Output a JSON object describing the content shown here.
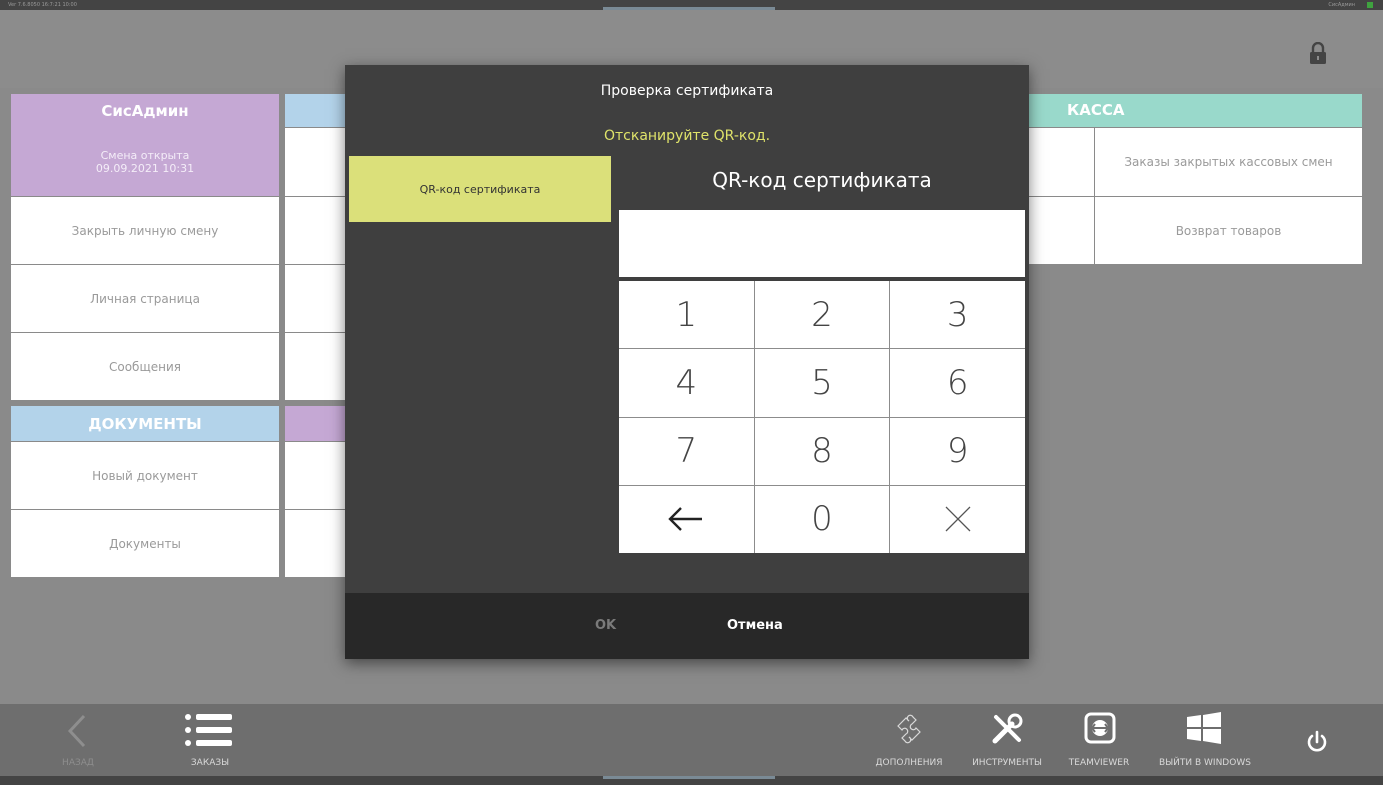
{
  "topbar": {
    "left_text": "Ver 7.6.8050 16:7:21 10:00",
    "right_text": "СисАдмин"
  },
  "user_panel": {
    "title": "СисАдмин",
    "status": "Смена открыта",
    "datetime": "09.09.2021 10:31",
    "items": [
      "Закрыть личную смену",
      "Личная страница",
      "Сообщения"
    ]
  },
  "documents_panel": {
    "title": "ДОКУМЕНТЫ",
    "items": [
      "Новый документ",
      "Документы"
    ]
  },
  "kassa_panel": {
    "title": "КАССА",
    "items": [
      "Заказы закрытых кассовых смен",
      "Возврат товаров"
    ]
  },
  "dialog": {
    "title": "Проверка сертификата",
    "subtitle": "Отсканируйте QR-код.",
    "tab_label": "QR-код сертификата",
    "field_label": "QR-код сертификата",
    "field_value": "",
    "keys": [
      "1",
      "2",
      "3",
      "4",
      "5",
      "6",
      "7",
      "8",
      "9",
      "←",
      "0",
      "×"
    ],
    "ok_label": "OK",
    "cancel_label": "Отмена"
  },
  "bottom": {
    "back_label": "НАЗАД",
    "orders_label": "ЗАКАЗЫ",
    "addons_label": "ДОПОЛНЕНИЯ",
    "tools_label": "ИНСТРУМЕНТЫ",
    "teamviewer_label": "TEAMVIEWER",
    "windows_label": "ВЫЙТИ В WINDOWS"
  },
  "colors": {
    "user_header": "#c5a8d4",
    "documents_header": "#b3d3ea",
    "kassa_header": "#99d9cb",
    "dialog_bg": "#3f3f3f",
    "accent_yellow": "#dbe07a"
  },
  "icons": [
    "lock-icon",
    "back-arrow-icon",
    "list-icon",
    "puzzle-icon",
    "tools-icon",
    "teamviewer-icon",
    "windows-icon",
    "power-icon"
  ]
}
